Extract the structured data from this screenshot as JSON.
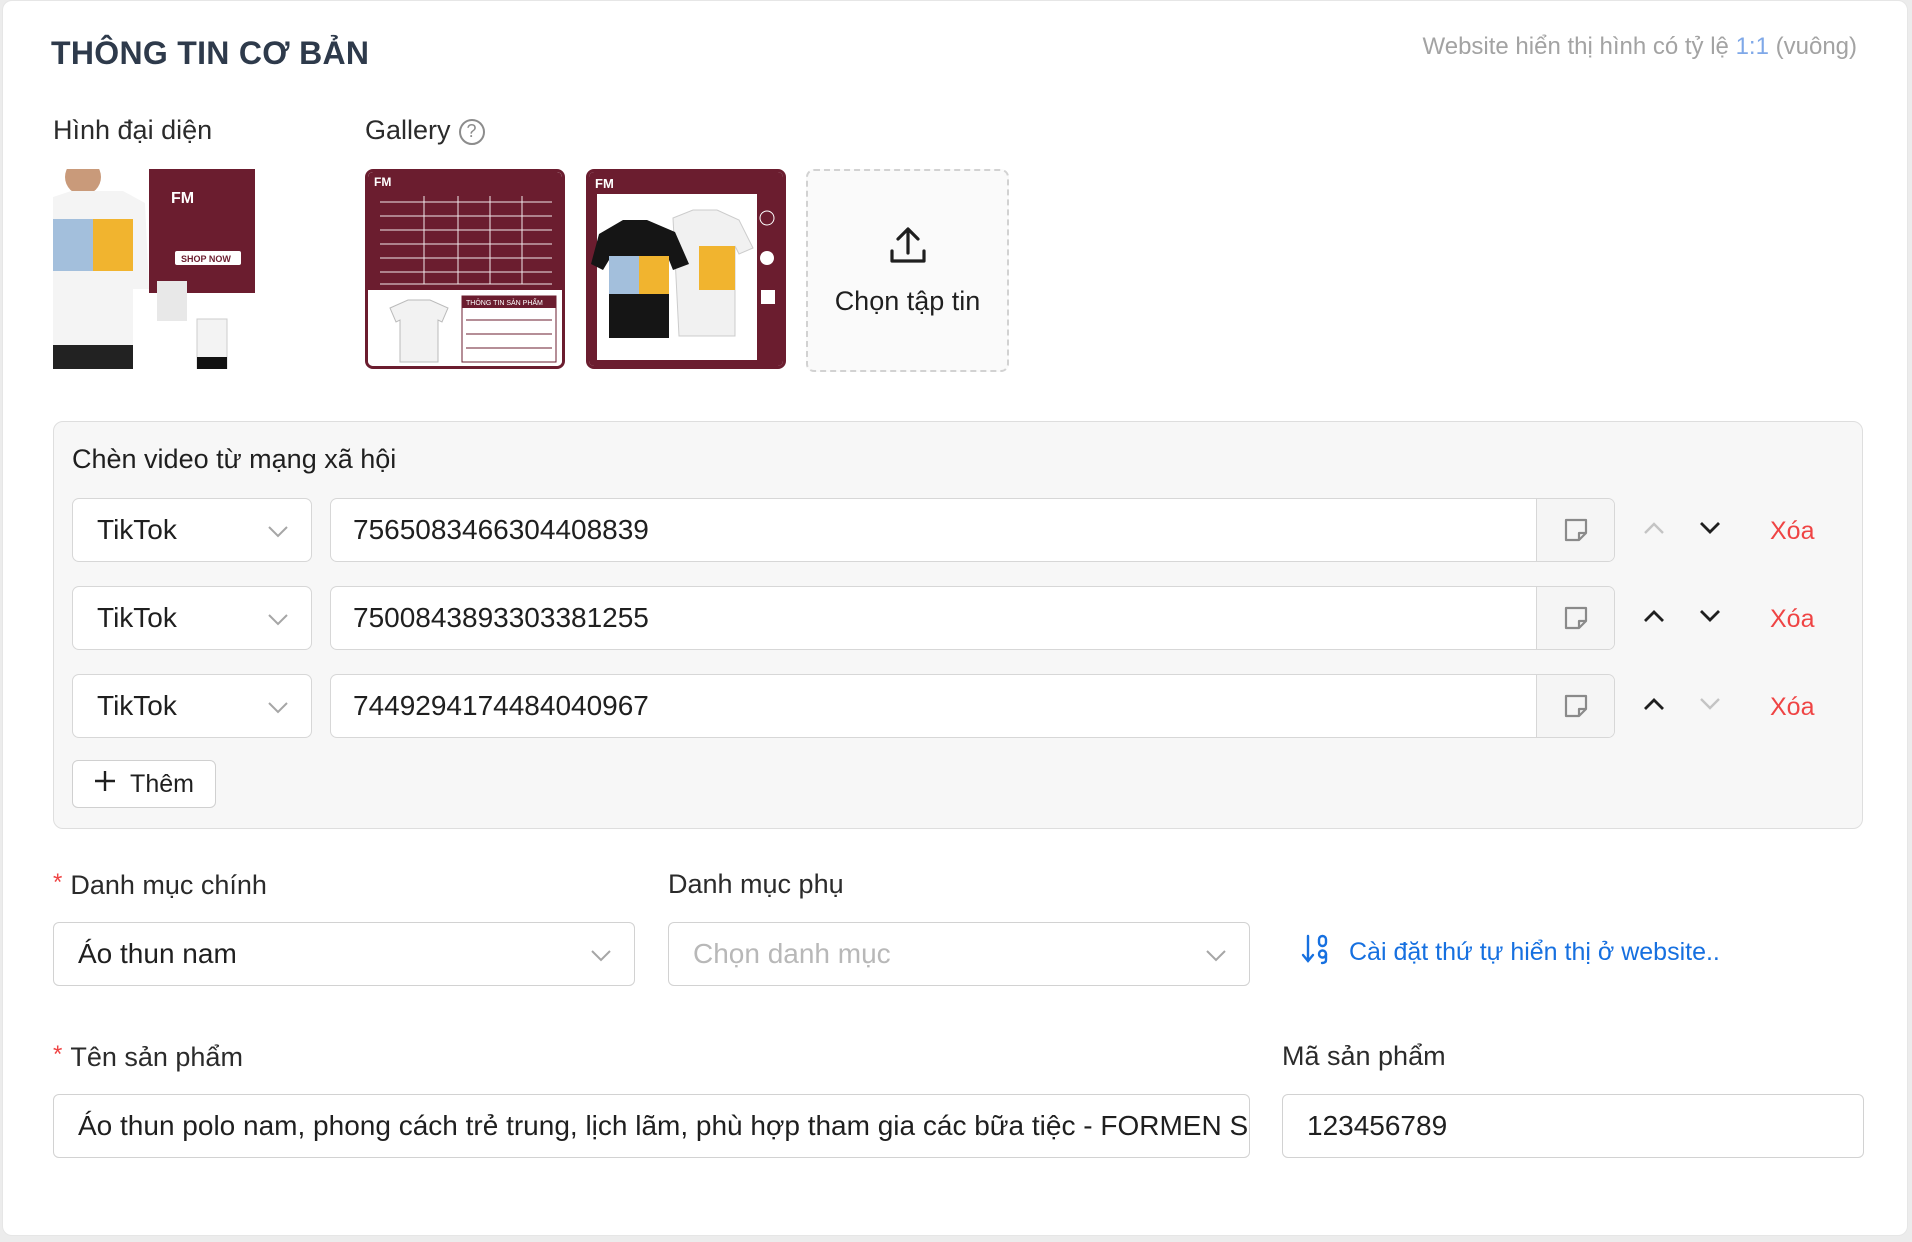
{
  "section": {
    "title": "THÔNG TIN CƠ BẢN",
    "ratio_note_prefix": "Website hiển thị hình có tỷ lệ",
    "ratio_value": "1:1",
    "ratio_suffix": "(vuông)"
  },
  "media": {
    "avatar_label": "Hình đại diện",
    "gallery_label": "Gallery",
    "help_glyph": "?",
    "upload_label": "Chọn tập tin",
    "avatar_logo": "FM",
    "avatar_banner": "SHOP NOW",
    "thumb1_logo": "FM",
    "thumb1_caption": "THÔNG TIN SẢN PHẨM",
    "thumb2_logo": "FM"
  },
  "video": {
    "title": "Chèn video từ mạng xã hội",
    "rows": [
      {
        "platform": "TikTok",
        "video_id": "7565083466304408839",
        "delete": "Xóa"
      },
      {
        "platform": "TikTok",
        "video_id": "7500843893303381255",
        "delete": "Xóa"
      },
      {
        "platform": "TikTok",
        "video_id": "7449294174484040967",
        "delete": "Xóa"
      }
    ],
    "add_label": "Thêm"
  },
  "category": {
    "main_label": "Danh mục chính",
    "main_value": "Áo thun nam",
    "sub_label": "Danh mục phụ",
    "sub_placeholder": "Chọn danh mục",
    "order_link": "Cài đặt thứ tự hiển thị ở website.."
  },
  "product": {
    "name_label": "Tên sản phẩm",
    "name_value": "Áo thun polo nam, phong cách trẻ trung, lịch lãm, phù hợp tham gia các bữa tiệc - FORMEN SHOP",
    "code_label": "Mã sản phẩm",
    "code_value": "123456789"
  },
  "required_mark": "*",
  "icons": [
    "help-icon",
    "upload-icon",
    "chevron-down-icon",
    "copy-note-icon",
    "arrow-up-icon",
    "arrow-down-icon",
    "plus-icon",
    "sort-numeric-icon"
  ],
  "colors": {
    "accent_blue": "#1670e0",
    "danger": "#ef4444",
    "brand_maroon": "#6b1d2f"
  }
}
